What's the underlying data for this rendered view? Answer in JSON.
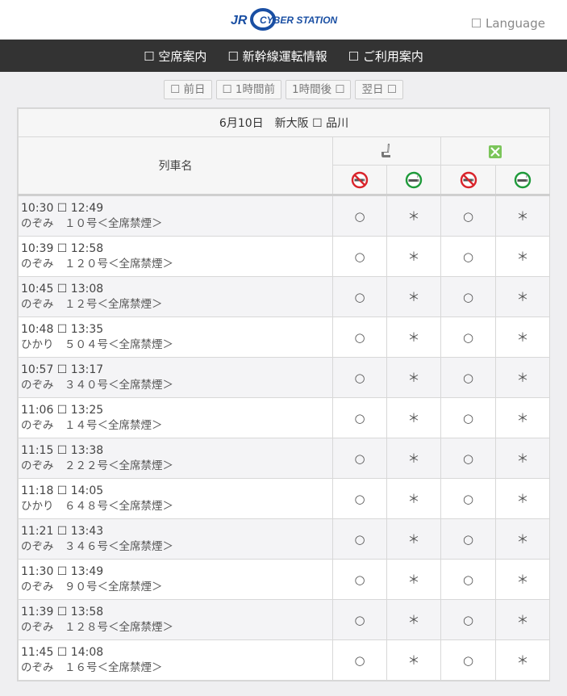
{
  "header": {
    "logo_jr": "JR",
    "logo_text": "CYBER STATION",
    "language_label": "☐ Language"
  },
  "nav": {
    "items": [
      "☐ 空席案内",
      "☐ 新幹線運転情報",
      "☐ ご利用案内"
    ]
  },
  "subnav": {
    "prev_day": "☐ 前日",
    "prev_hour": "☐ 1時間前",
    "next_hour": "1時間後 ☐",
    "next_day": "翌日 ☐"
  },
  "table": {
    "title": "6月10日　新大阪 ☐ 品川",
    "col_train_label": "列車名",
    "icons": {
      "reserved_seat": "seat-icon",
      "green_car": "green-car-icon",
      "non_smoking": "no-smoking-icon",
      "smoking": "smoking-icon"
    },
    "colors": {
      "non_smoking": "#d9242b",
      "smoking": "#1e9a3a",
      "green": "#6cc04a"
    },
    "rows": [
      {
        "time": "10:30 ☐ 12:49",
        "name": "のぞみ　１０号＜全席禁煙＞",
        "c1": "○",
        "c2": "＊",
        "c3": "○",
        "c4": "＊"
      },
      {
        "time": "10:39 ☐ 12:58",
        "name": "のぞみ　１２０号＜全席禁煙＞",
        "c1": "○",
        "c2": "＊",
        "c3": "○",
        "c4": "＊"
      },
      {
        "time": "10:45 ☐ 13:08",
        "name": "のぞみ　１２号＜全席禁煙＞",
        "c1": "○",
        "c2": "＊",
        "c3": "○",
        "c4": "＊"
      },
      {
        "time": "10:48 ☐ 13:35",
        "name": "ひかり　５０４号＜全席禁煙＞",
        "c1": "○",
        "c2": "＊",
        "c3": "○",
        "c4": "＊"
      },
      {
        "time": "10:57 ☐ 13:17",
        "name": "のぞみ　３４０号＜全席禁煙＞",
        "c1": "○",
        "c2": "＊",
        "c3": "○",
        "c4": "＊"
      },
      {
        "time": "11:06 ☐ 13:25",
        "name": "のぞみ　１４号＜全席禁煙＞",
        "c1": "○",
        "c2": "＊",
        "c3": "○",
        "c4": "＊"
      },
      {
        "time": "11:15 ☐ 13:38",
        "name": "のぞみ　２２２号＜全席禁煙＞",
        "c1": "○",
        "c2": "＊",
        "c3": "○",
        "c4": "＊"
      },
      {
        "time": "11:18 ☐ 14:05",
        "name": "ひかり　６４８号＜全席禁煙＞",
        "c1": "○",
        "c2": "＊",
        "c3": "○",
        "c4": "＊"
      },
      {
        "time": "11:21 ☐ 13:43",
        "name": "のぞみ　３４６号＜全席禁煙＞",
        "c1": "○",
        "c2": "＊",
        "c3": "○",
        "c4": "＊"
      },
      {
        "time": "11:30 ☐ 13:49",
        "name": "のぞみ　９０号＜全席禁煙＞",
        "c1": "○",
        "c2": "＊",
        "c3": "○",
        "c4": "＊"
      },
      {
        "time": "11:39 ☐ 13:58",
        "name": "のぞみ　１２８号＜全席禁煙＞",
        "c1": "○",
        "c2": "＊",
        "c3": "○",
        "c4": "＊"
      },
      {
        "time": "11:45 ☐ 14:08",
        "name": "のぞみ　１６号＜全席禁煙＞",
        "c1": "○",
        "c2": "＊",
        "c3": "○",
        "c4": "＊"
      }
    ]
  }
}
